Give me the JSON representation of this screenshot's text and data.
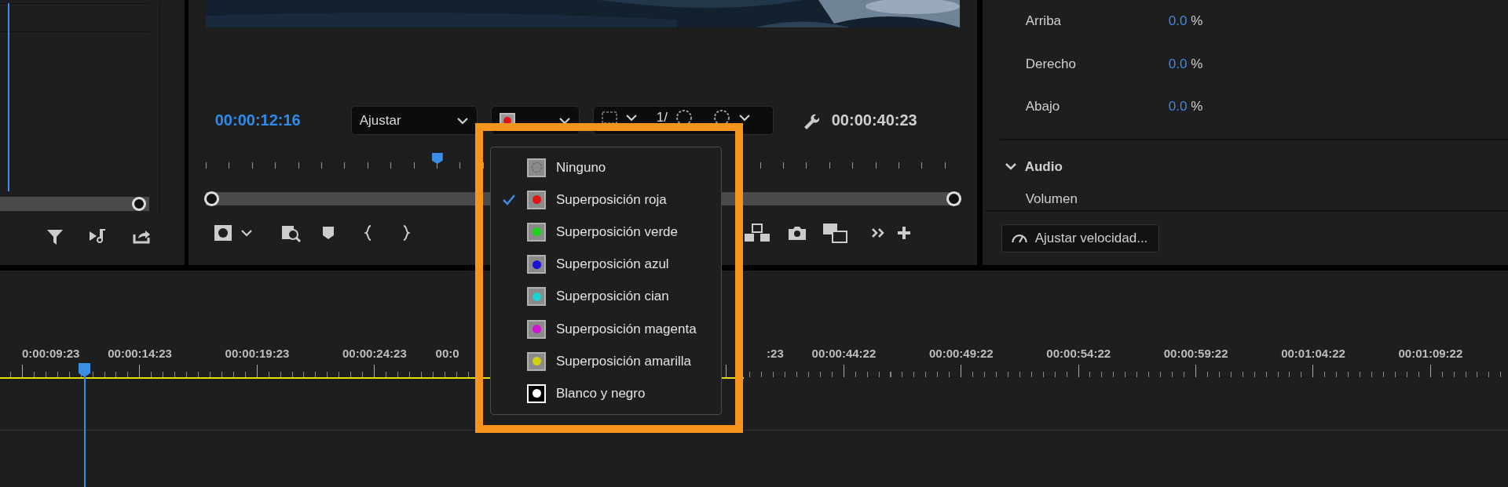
{
  "program_monitor": {
    "current_time": "00:00:12:16",
    "zoom_dropdown": {
      "value": "Ajustar"
    },
    "resolution_dropdown": {
      "value": "1/"
    },
    "duration": "00:00:40:23"
  },
  "effect_controls": {
    "properties": [
      {
        "label": "Arriba",
        "value": "0.0",
        "unit": "%"
      },
      {
        "label": "Derecho",
        "value": "0.0",
        "unit": "%"
      },
      {
        "label": "Abajo",
        "value": "0.0",
        "unit": "%"
      }
    ],
    "section": {
      "label": "Audio",
      "expanded": true
    },
    "property_below": "Volumen",
    "speed_button": "Ajustar velocidad..."
  },
  "timeline": {
    "time_labels": [
      {
        "text": "0:00:09:23",
        "kind": "tail"
      },
      {
        "text": "00:00:14:23",
        "kind": "whole"
      },
      {
        "text": "00:00:19:23",
        "kind": "whole"
      },
      {
        "text": "00:00:24:23",
        "kind": "whole"
      },
      {
        "text": "00:0",
        "kind": "head"
      },
      {
        "text": ":23",
        "kind": "tail"
      },
      {
        "text": "00:00:44:22",
        "kind": "whole"
      },
      {
        "text": "00:00:49:22",
        "kind": "whole"
      },
      {
        "text": "00:00:54:22",
        "kind": "whole"
      },
      {
        "text": "00:00:59:22",
        "kind": "whole"
      },
      {
        "text": "00:01:04:22",
        "kind": "whole"
      },
      {
        "text": "00:01:09:22",
        "kind": "whole"
      }
    ]
  },
  "overlay_menu": {
    "items": [
      {
        "label": "Ninguno",
        "kind": "none",
        "selected": false
      },
      {
        "label": "Superposición roja",
        "kind": "color",
        "color": "#e01414",
        "selected": true
      },
      {
        "label": "Superposición verde",
        "kind": "color",
        "color": "#1ed21e",
        "selected": false
      },
      {
        "label": "Superposición azul",
        "kind": "color",
        "color": "#1414d2",
        "selected": false
      },
      {
        "label": "Superposición cian",
        "kind": "color",
        "color": "#1ed2d2",
        "selected": false
      },
      {
        "label": "Superposición magenta",
        "kind": "color",
        "color": "#d214d2",
        "selected": false
      },
      {
        "label": "Superposición amarilla",
        "kind": "color",
        "color": "#d2d214",
        "selected": false
      },
      {
        "label": "Blanco y negro",
        "kind": "mono",
        "selected": false
      }
    ]
  }
}
